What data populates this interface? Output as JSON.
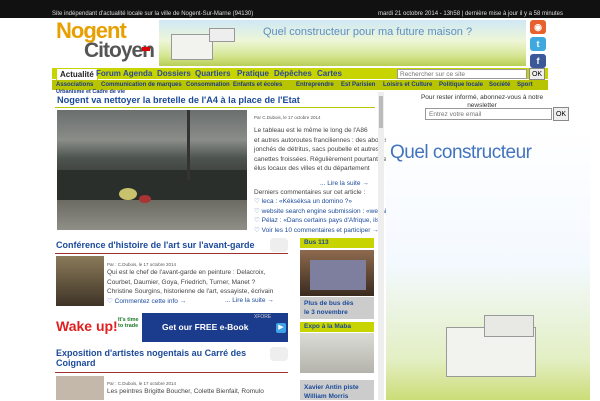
{
  "topbar": {
    "left": "Site indépendant d'actualité locale sur la ville de Nogent-Sur-Marne (94130)",
    "right": "mardi 21 octobre 2014 - 13h58 | dernière mise à jour il y a 58 minutes"
  },
  "logo": {
    "line1": "Nogent",
    "line2": "Citoyen"
  },
  "banner": {
    "text": "Quel constructeur pour ma future maison ?"
  },
  "nav": {
    "items": [
      "Actualité",
      "Forum",
      "Agenda",
      "Dossiers",
      "Quartiers",
      "Pratique",
      "Dépêches",
      "Cartes"
    ]
  },
  "search": {
    "placeholder": "Rechercher sur ce site",
    "button": "OK"
  },
  "subnav": {
    "items": [
      "Associations",
      "Communication de marques",
      "Consommation",
      "Enfants et écoles",
      "Entreprendre",
      "Est Parisien",
      "Loisirs et Culture",
      "Politique locale",
      "Société",
      "Sport"
    ]
  },
  "breadcrumb": "Urbanisme et Cadre de vie",
  "article1": {
    "title": "Nogent va nettoyer la bretelle de l'A4 à la place de l'Etat",
    "meta": "Par C.Dubois, le 17 octobre 2014",
    "body": [
      "Le tableau est le même le long de l'A86",
      "et autres autoroutes franciliennes : des abords",
      "jonchés de détritus,  sacs poubelle et autres",
      "canettes froissées. Régulièrement pourtant, les",
      "élus locaux des villes et du département"
    ],
    "more": "... Lire la suite →",
    "comments_title": "Derniers commentaires sur cet article :",
    "comments": [
      "leca : «Kékséksa un domino ?»",
      "website search engine submission : «website",
      "Pélaz : «Dans certains pays d'Afrique, ils"
    ],
    "all": "Voir les 10 commentaires et participer →"
  },
  "article2": {
    "title": "Conférence d'histoire de l'art sur l'avant-garde",
    "meta": "Par : C.Dubois, le 17 octobre 2014",
    "body": [
      "Qui est le chef de l'avant-garde en peinture : Delacroix,",
      "Courbet, Daumier, Goya, Friedrich, Turner, Manet ?",
      "Christine Sourgins, historienne de l'art, essayiste, écrivain"
    ],
    "comment": "Commentez cette info →",
    "more": "... Lire la suite →"
  },
  "ad": {
    "wake": "Wake up!",
    "its": "It's time to trade",
    "cta": "Get our FREE e-Book",
    "brand": "XFORE"
  },
  "article3": {
    "title1": "Exposition d'artistes nogentais au Carré des",
    "title2": "Coignard",
    "meta": "Par : C.Dubois, le 17 octobre 2014",
    "body": "Les peintres Brigitte Boucher, Colette Bienfait, Romulo"
  },
  "sidebar": {
    "bus_title": "Bus 113",
    "bus_caption": [
      "Plus de bus dès",
      "le 3 novembre"
    ],
    "expo_title": "Expo à la Maba",
    "expo_caption": [
      "Xavier Antin piste",
      "William Morris"
    ]
  },
  "newsletter": {
    "title": "Pour rester informé, abonnez-vous à notre newsletter",
    "placeholder": "Entrez votre email",
    "button": "OK"
  },
  "bigad": {
    "text": "Quel constructeur"
  },
  "colors": {
    "accent": "#c8d400",
    "link": "#1b4a9a"
  }
}
